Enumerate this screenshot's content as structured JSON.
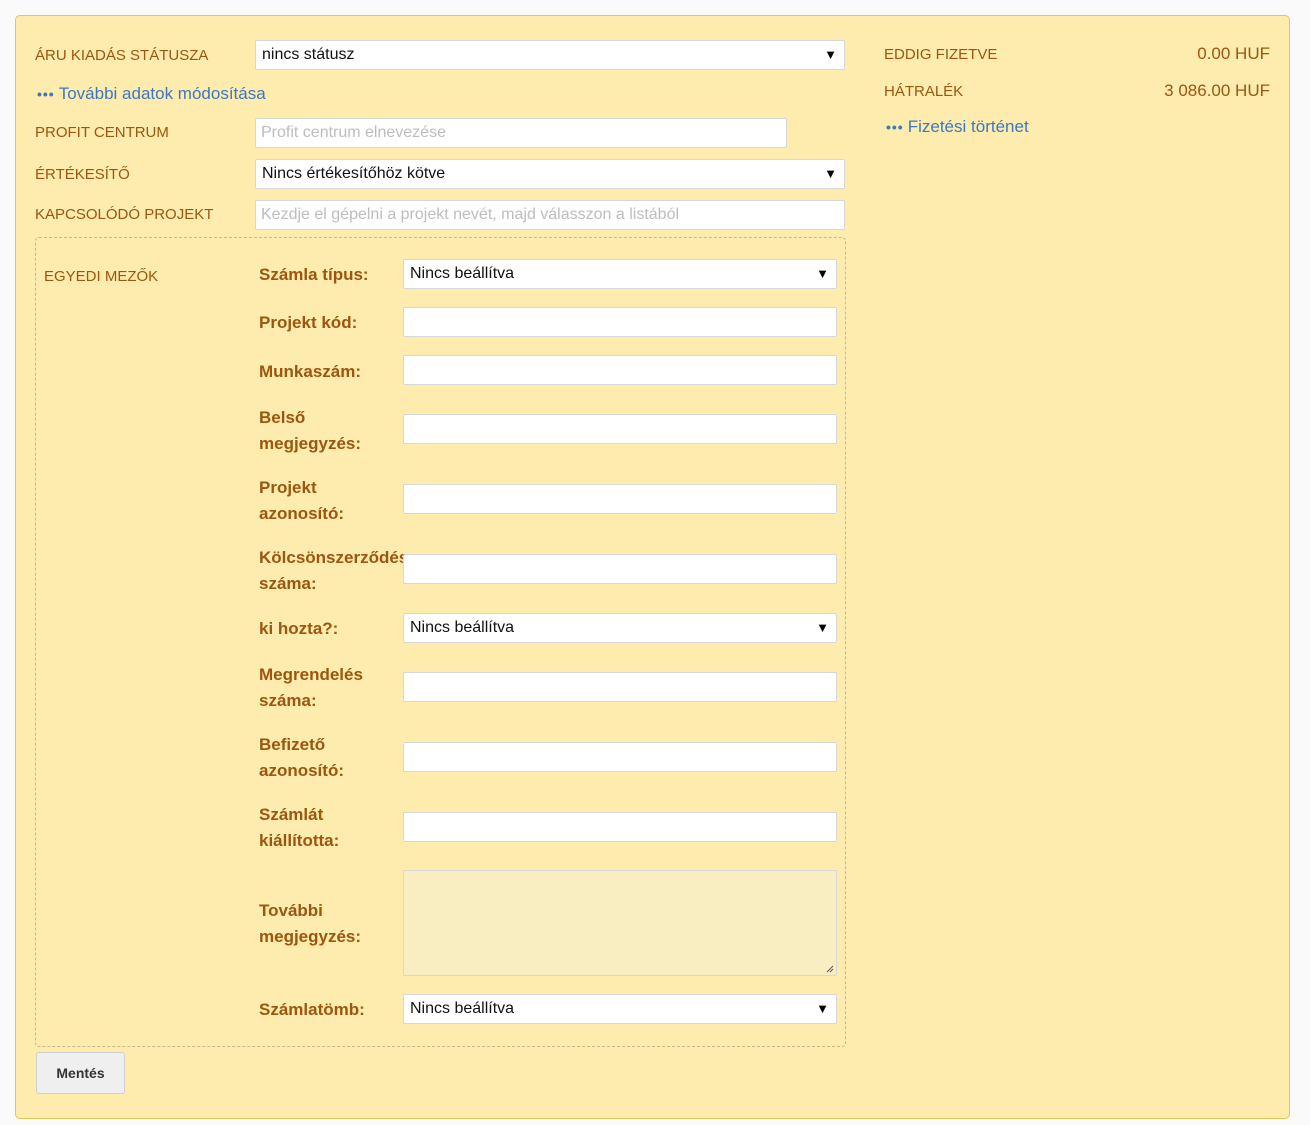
{
  "fields": {
    "status_label": "Áru kiadás státusza",
    "status_value": "nincs státusz",
    "more_data_link": "További adatok módosítása",
    "profit_center_label": "Profit centrum",
    "profit_center_placeholder": "Profit centrum elnevezése",
    "seller_label": "Értékesítő",
    "seller_value": "Nincs értékesítőhöz kötve",
    "project_label": "Kapcsolódó projekt",
    "project_placeholder": "Kezdje el gépelni a projekt nevét, majd válasszon a listából"
  },
  "custom": {
    "section_label": "Egyedi mezők",
    "invoice_type_label": "Számla típus:",
    "invoice_type_value": "Nincs beállítva",
    "project_code_label": "Projekt kód:",
    "job_number_label": "Munkaszám:",
    "internal_note_label": "Belső megjegyzés:",
    "project_id_label": "Projekt azonosító:",
    "loan_contract_label": "Kölcsönszerződés száma:",
    "brought_by_label": "ki hozta?:",
    "brought_by_value": "Nincs beállítva",
    "order_number_label": "Megrendelés száma:",
    "payer_id_label": "Befizető azonosító:",
    "issued_by_label": "Számlát kiállította:",
    "further_notes_label": "További megjegyzés:",
    "invoice_block_label": "Számlatömb:",
    "invoice_block_value": "Nincs beállítva"
  },
  "actions": {
    "save_label": "Mentés"
  },
  "payment": {
    "paid_label": "Eddig fizetve",
    "paid_value": "0.00 HUF",
    "arrears_label": "Hátralék",
    "arrears_value": "3 086.00 HUF",
    "history_link": "Fizetési történet"
  },
  "icons": {
    "dots": "more-dots-icon",
    "arrow": "dropdown-arrow-icon",
    "grip": "resize-grip-icon"
  },
  "colors": {
    "panel_bg": "#fdecad",
    "label": "#9c5610",
    "link": "#3d77c4"
  }
}
